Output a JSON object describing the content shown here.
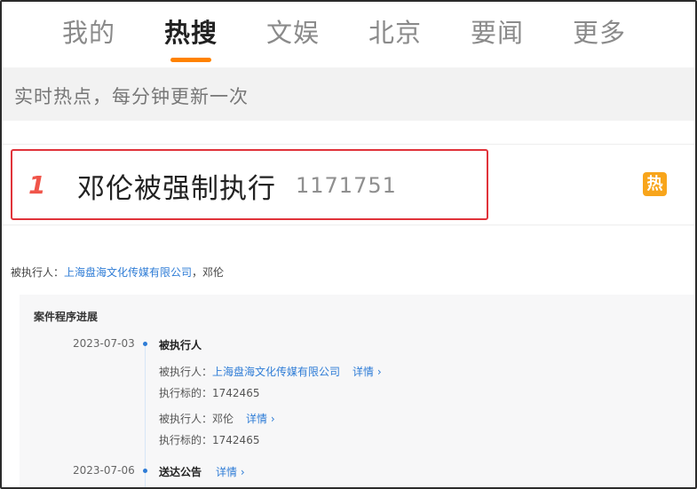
{
  "tabs": [
    {
      "label": "我的"
    },
    {
      "label": "热搜"
    },
    {
      "label": "文娱"
    },
    {
      "label": "北京"
    },
    {
      "label": "要闻"
    },
    {
      "label": "更多"
    }
  ],
  "subtitle": "实时热点，每分钟更新一次",
  "hot_item": {
    "rank": "1",
    "title": "邓伦被强制执行",
    "count": "1171751",
    "badge": "热"
  },
  "executed_party": {
    "label": "被执行人：",
    "company": "上海盘海文化传媒有限公司",
    "separator": "，",
    "person": "邓伦"
  },
  "case": {
    "title": "案件程序进展",
    "entries": [
      {
        "date": "2023-07-03",
        "event": "被执行人",
        "lines": [
          {
            "label": "被执行人：",
            "value": "上海盘海文化传媒有限公司",
            "link": "详情 ›"
          },
          {
            "label": "执行标的：",
            "value": "1742465"
          },
          {
            "label": "被执行人：",
            "value": "邓伦",
            "link": "详情 ›"
          },
          {
            "label": "执行标的：",
            "value": "1742465"
          }
        ]
      },
      {
        "date": "2023-07-06",
        "event": "送达公告",
        "link": "详情 ›"
      }
    ]
  },
  "colors": {
    "accent": "#ff8200",
    "highlight_border": "#e0333a",
    "rank": "#f0554a",
    "badge": "#f8a51b",
    "link": "#2e7cd6"
  }
}
